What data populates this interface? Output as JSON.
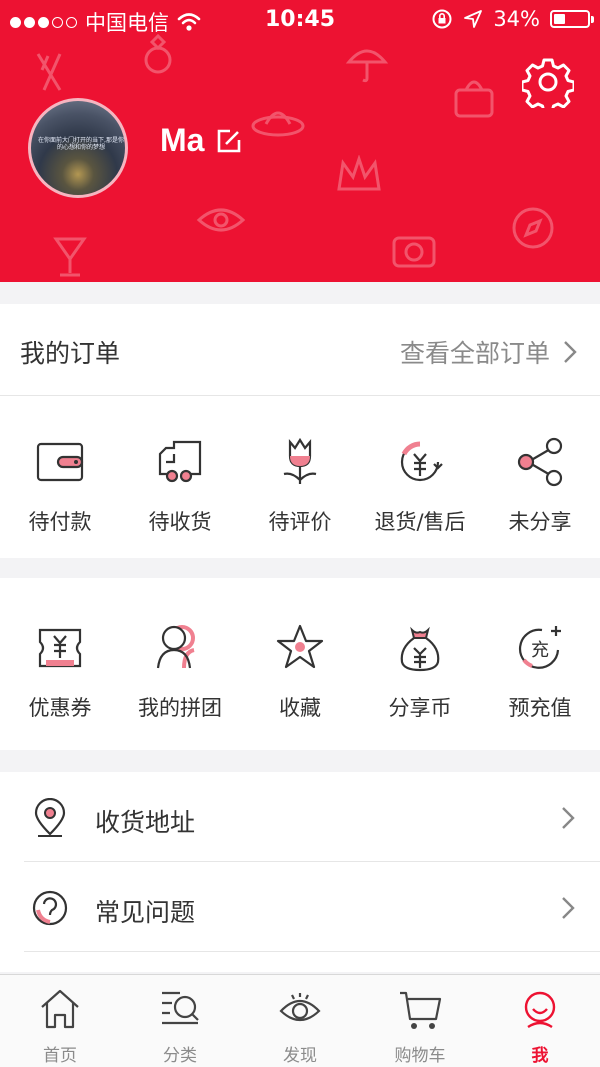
{
  "status_bar": {
    "carrier": "中国电信",
    "time": "10:45",
    "battery": "34%",
    "battery_level": 0.34
  },
  "profile": {
    "username": "Ma",
    "avatar_caption": "在你面前大门打开的当下,那是你的心想和你的梦想"
  },
  "orders": {
    "title": "我的订单",
    "view_all": "查看全部订单",
    "items": [
      {
        "label": "待付款",
        "icon": "wallet-icon"
      },
      {
        "label": "待收货",
        "icon": "delivery-truck-icon"
      },
      {
        "label": "待评价",
        "icon": "flower-review-icon"
      },
      {
        "label": "退货/售后",
        "icon": "refund-yen-icon"
      },
      {
        "label": "未分享",
        "icon": "share-icon"
      }
    ]
  },
  "tools": {
    "items": [
      {
        "label": "优惠券",
        "icon": "coupon-icon"
      },
      {
        "label": "我的拼团",
        "icon": "group-buy-icon"
      },
      {
        "label": "收藏",
        "icon": "star-icon"
      },
      {
        "label": "分享币",
        "icon": "money-bag-icon"
      },
      {
        "label": "预充值",
        "icon": "recharge-icon"
      }
    ]
  },
  "menu": {
    "items": [
      {
        "label": "收货地址",
        "icon": "location-pin-icon"
      },
      {
        "label": "常见问题",
        "icon": "help-bubble-icon"
      }
    ]
  },
  "tabbar": {
    "tabs": [
      {
        "label": "首页",
        "icon": "home-icon"
      },
      {
        "label": "分类",
        "icon": "category-search-icon"
      },
      {
        "label": "发现",
        "icon": "eye-icon"
      },
      {
        "label": "购物车",
        "icon": "cart-icon"
      },
      {
        "label": "我",
        "icon": "user-face-icon"
      }
    ],
    "active_index": 4
  },
  "colors": {
    "brand_red": "#ed1232",
    "accent_pink": "#f08090"
  }
}
